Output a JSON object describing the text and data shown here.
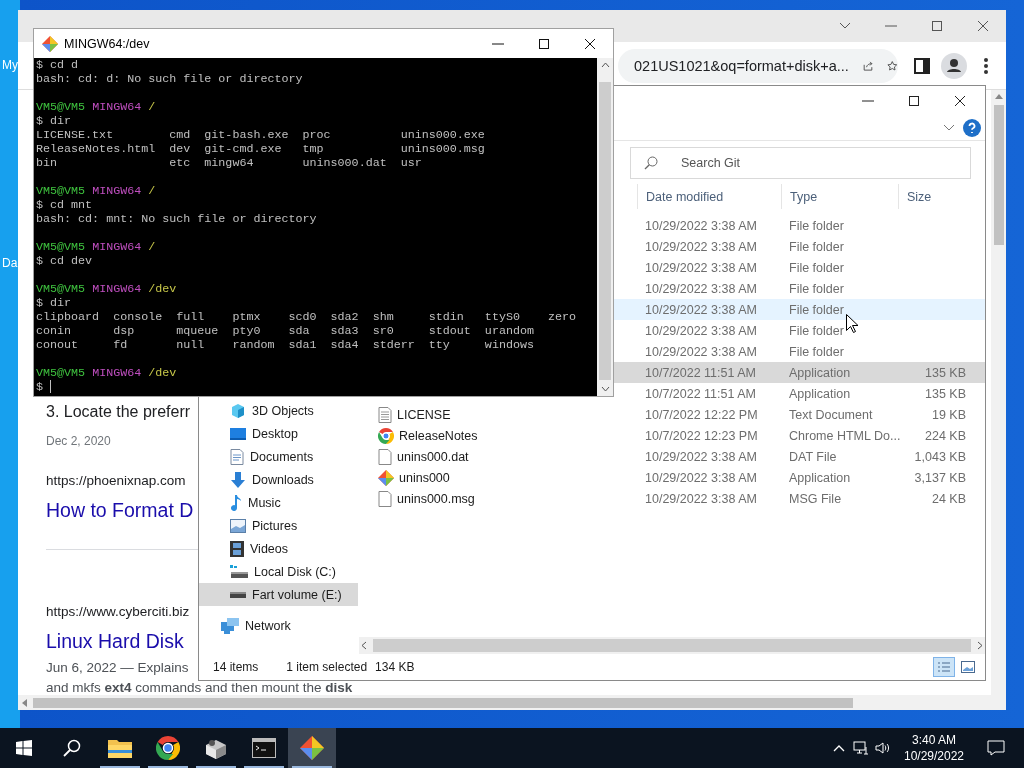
{
  "desktop": {
    "icons": [
      {
        "label": "My"
      },
      {
        "label": "Da"
      }
    ]
  },
  "browser": {
    "address": "021US1021&oq=format+disk+a...",
    "blocks": [
      {
        "kind": "heading",
        "text": "3. Locate the preferr"
      },
      {
        "kind": "date",
        "text": "Dec 2, 2020"
      },
      {
        "kind": "url",
        "text": "https://phoenixnap.com"
      },
      {
        "kind": "title",
        "text": "How to Format D"
      },
      {
        "kind": "rule"
      },
      {
        "kind": "url",
        "text": "https://www.cyberciti.biz"
      },
      {
        "kind": "title",
        "text": "Linux Hard Disk"
      },
      {
        "kind": "snippet",
        "text": "Jun 6, 2022 — Explains"
      },
      {
        "kind": "continuation",
        "text": "and mkfs **ext4** commands and then mount the **disk**"
      }
    ]
  },
  "explorer": {
    "search": {
      "placeholder": "Search Git"
    },
    "columns": [
      "Date modified",
      "Type",
      "Size"
    ],
    "nav": [
      {
        "label": "3D Objects",
        "selected": false
      },
      {
        "label": "Desktop",
        "selected": false
      },
      {
        "label": "Documents",
        "selected": false
      },
      {
        "label": "Downloads",
        "selected": false
      },
      {
        "label": "Music",
        "selected": false
      },
      {
        "label": "Pictures",
        "selected": false
      },
      {
        "label": "Videos",
        "selected": false
      },
      {
        "label": "Local Disk (C:)",
        "selected": false
      },
      {
        "label": "Fart volume (E:)",
        "selected": true
      },
      {
        "label": "Network",
        "selected": false
      }
    ],
    "rows": [
      {
        "date": "10/29/2022 3:38 AM",
        "type": "File folder",
        "selected": false,
        "hovered": false
      },
      {
        "date": "10/29/2022 3:38 AM",
        "type": "File folder",
        "selected": false,
        "hovered": false
      },
      {
        "date": "10/29/2022 3:38 AM",
        "type": "File folder",
        "selected": false,
        "hovered": false
      },
      {
        "date": "10/29/2022 3:38 AM",
        "type": "File folder",
        "selected": false,
        "hovered": false
      },
      {
        "date": "10/29/2022 3:38 AM",
        "type": "File folder",
        "selected": false,
        "hovered": true
      },
      {
        "date": "10/29/2022 3:38 AM",
        "type": "File folder",
        "selected": false,
        "hovered": false
      },
      {
        "date": "10/29/2022 3:38 AM",
        "type": "File folder",
        "selected": false,
        "hovered": false
      },
      {
        "date": "10/7/2022 11:51 AM",
        "type": "Application",
        "size": "135 KB",
        "selected": true,
        "hovered": false
      },
      {
        "date": "10/7/2022 11:51 AM",
        "type": "Application",
        "size": "135 KB",
        "selected": false,
        "hovered": false
      },
      {
        "name": "LICENSE",
        "date": "10/7/2022 12:22 PM",
        "type": "Text Document",
        "size": "19 KB",
        "selected": false,
        "hovered": false
      },
      {
        "name": "ReleaseNotes",
        "date": "10/7/2022 12:23 PM",
        "type": "Chrome HTML Do...",
        "size": "224 KB",
        "selected": false,
        "hovered": false
      },
      {
        "name": "unins000.dat",
        "date": "10/29/2022 3:38 AM",
        "type": "DAT File",
        "size": "1,043 KB",
        "selected": false,
        "hovered": false
      },
      {
        "name": "unins000",
        "date": "10/29/2022 3:38 AM",
        "type": "Application",
        "size": "3,137 KB",
        "selected": false,
        "hovered": false
      },
      {
        "name": "unins000.msg",
        "date": "10/29/2022 3:38 AM",
        "type": "MSG File",
        "size": "24 KB",
        "selected": false,
        "hovered": false
      }
    ],
    "status": {
      "count": "14 items",
      "selection": "1 item selected",
      "size": "134 KB"
    },
    "views": [
      {
        "kind": "details",
        "selected": true
      },
      {
        "kind": "preview",
        "selected": false
      }
    ]
  },
  "terminal": {
    "title": "MINGW64:/dev",
    "lines": [
      {
        "kind": "output",
        "text": "$ cd d"
      },
      {
        "kind": "output",
        "text": "bash: cd: d: No such file or directory"
      },
      {
        "kind": "blank"
      },
      {
        "kind": "prompt",
        "user": "VM5@VM5",
        "shell": "MINGW64",
        "path": "/"
      },
      {
        "kind": "output",
        "text": "$ dir"
      },
      {
        "kind": "output",
        "text": "LICENSE.txt        cmd  git-bash.exe  proc          unins000.exe"
      },
      {
        "kind": "output",
        "text": "ReleaseNotes.html  dev  git-cmd.exe   tmp           unins000.msg"
      },
      {
        "kind": "output",
        "text": "bin                etc  mingw64       unins000.dat  usr"
      },
      {
        "kind": "blank"
      },
      {
        "kind": "prompt",
        "user": "VM5@VM5",
        "shell": "MINGW64",
        "path": "/"
      },
      {
        "kind": "output",
        "text": "$ cd mnt"
      },
      {
        "kind": "output",
        "text": "bash: cd: mnt: No such file or directory"
      },
      {
        "kind": "blank"
      },
      {
        "kind": "prompt",
        "user": "VM5@VM5",
        "shell": "MINGW64",
        "path": "/"
      },
      {
        "kind": "output",
        "text": "$ cd dev"
      },
      {
        "kind": "blank"
      },
      {
        "kind": "prompt",
        "user": "VM5@VM5",
        "shell": "MINGW64",
        "path": "/dev"
      },
      {
        "kind": "output",
        "text": "$ dir"
      },
      {
        "kind": "output",
        "text": "clipboard  console  full    ptmx    scd0  sda2  shm     stdin   ttyS0    zero"
      },
      {
        "kind": "output",
        "text": "conin      dsp      mqueue  pty0    sda   sda3  sr0     stdout  urandom"
      },
      {
        "kind": "output",
        "text": "conout     fd       null    random  sda1  sda4  stderr  tty     windows"
      },
      {
        "kind": "blank"
      },
      {
        "kind": "prompt",
        "user": "VM5@VM5",
        "shell": "MINGW64",
        "path": "/dev"
      },
      {
        "kind": "input",
        "text": "$"
      }
    ]
  },
  "taskbar": {
    "apps": [
      {
        "running": true,
        "active": false
      },
      {
        "running": true,
        "active": false
      },
      {
        "running": true,
        "active": false
      },
      {
        "running": true,
        "active": false
      },
      {
        "running": true,
        "active": true
      }
    ],
    "time": "3:40 AM",
    "date": "10/29/2022"
  }
}
